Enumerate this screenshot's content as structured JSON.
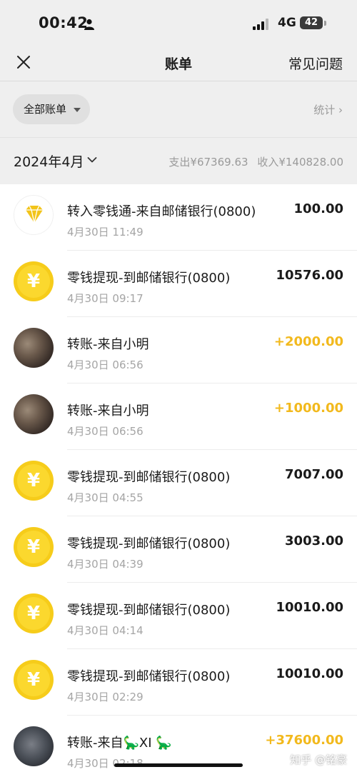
{
  "status_bar": {
    "time": "00:42",
    "network": "4G",
    "battery": "42"
  },
  "nav": {
    "title": "账单",
    "faq_label": "常见问题"
  },
  "filter": {
    "label": "全部账单",
    "stats_label": "统计 ›"
  },
  "month_header": {
    "month": "2024年4月",
    "expense": "支出¥67369.63",
    "income": "收入¥140828.00"
  },
  "colors": {
    "coin": "#f6cc1a",
    "income_amount": "#f2b91d",
    "diamond": "#f2c41a"
  },
  "transactions": [
    {
      "icon": "diamond-icon",
      "title": "转入零钱通-来自邮储银行(0800)",
      "date": "4月30日 11:49",
      "amount": "100.00"
    },
    {
      "icon": "yuan-coin-icon",
      "title": "零钱提现-到邮储银行(0800)",
      "date": "4月30日 09:17",
      "amount": "10576.00"
    },
    {
      "icon": "avatar-photo",
      "title": "转账-来自小明",
      "date": "4月30日 06:56",
      "amount": "+2000.00"
    },
    {
      "icon": "avatar-photo",
      "title": "转账-来自小明",
      "date": "4月30日 06:56",
      "amount": "+1000.00"
    },
    {
      "icon": "yuan-coin-icon",
      "title": "零钱提现-到邮储银行(0800)",
      "date": "4月30日 04:55",
      "amount": "7007.00"
    },
    {
      "icon": "yuan-coin-icon",
      "title": "零钱提现-到邮储银行(0800)",
      "date": "4月30日 04:39",
      "amount": "3003.00"
    },
    {
      "icon": "yuan-coin-icon",
      "title": "零钱提现-到邮储银行(0800)",
      "date": "4月30日 04:14",
      "amount": "10010.00"
    },
    {
      "icon": "yuan-coin-icon",
      "title": "零钱提现-到邮储银行(0800)",
      "date": "4月30日 02:29",
      "amount": "10010.00"
    },
    {
      "icon": "avatar-photo",
      "title": "转账-来自🦕XI 🦕",
      "date": "4月30日 02:18",
      "amount": "+37600.00"
    }
  ],
  "coin_symbol": "¥",
  "watermark": "知乎 @铭豪"
}
